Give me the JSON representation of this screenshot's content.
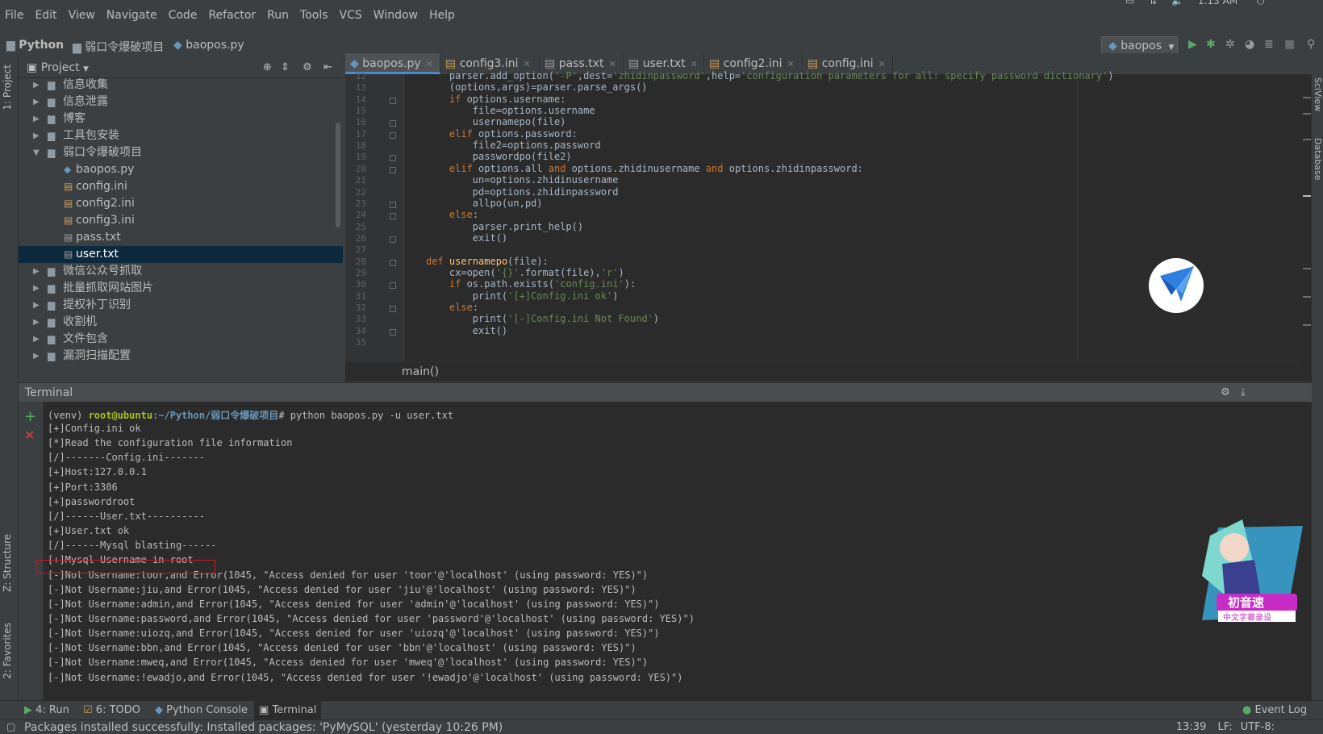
{
  "menu": [
    "File",
    "Edit",
    "View",
    "Navigate",
    "Code",
    "Refactor",
    "Run",
    "Tools",
    "VCS",
    "Window",
    "Help"
  ],
  "tray_time": "1:13 AM",
  "nav": {
    "crumbs": [
      "Python",
      "弱口令爆破项目",
      "baopos.py"
    ]
  },
  "run_config": "baopos",
  "left_tabs": {
    "project": "1: Project",
    "structure": "Z: Structure",
    "favorites": "2: Favorites"
  },
  "project": {
    "title": "Project",
    "items": [
      {
        "label": "信息收集",
        "type": "folder"
      },
      {
        "label": "信息泄露",
        "type": "folder"
      },
      {
        "label": "博客",
        "type": "folder"
      },
      {
        "label": "工具包安装",
        "type": "folder"
      },
      {
        "label": "弱口令爆破项目",
        "type": "folder-open"
      },
      {
        "label": "baopos.py",
        "type": "py"
      },
      {
        "label": "config.ini",
        "type": "ini"
      },
      {
        "label": "config2.ini",
        "type": "ini"
      },
      {
        "label": "config3.ini",
        "type": "ini"
      },
      {
        "label": "pass.txt",
        "type": "txt"
      },
      {
        "label": "user.txt",
        "type": "txt"
      },
      {
        "label": "微信公众号抓取",
        "type": "folder"
      },
      {
        "label": "批量抓取网站图片",
        "type": "folder"
      },
      {
        "label": "提权补丁识别",
        "type": "folder"
      },
      {
        "label": "收割机",
        "type": "folder"
      },
      {
        "label": "文件包含",
        "type": "folder"
      },
      {
        "label": "漏洞扫描配置",
        "type": "folder"
      }
    ]
  },
  "editor": {
    "tabs": [
      "baopos.py",
      "config3.ini",
      "pass.txt",
      "user.txt",
      "config2.ini",
      "config.ini"
    ],
    "line_numbers": [
      "12",
      "13",
      "14",
      "15",
      "16",
      "17",
      "18",
      "19",
      "20",
      "21",
      "22",
      "23",
      "24",
      "25",
      "26",
      "27",
      "28",
      "29",
      "30",
      "31",
      "32",
      "33",
      "34",
      "35"
    ],
    "code": [
      "    parser.add_option('-P',dest='zhidinpassword',help='configuration parameters for all: specify password dictionary')",
      "    (options,args)=parser.parse_args()",
      "    if options.username:",
      "        file=options.username",
      "        usernamepo(file)",
      "    elif options.password:",
      "        file2=options.password",
      "        passwordpo(file2)",
      "    elif options.all and options.zhidinusername and options.zhidinpassword:",
      "        un=options.zhidinusername",
      "        pd=options.zhidinpassword",
      "        allpo(un,pd)",
      "    else:",
      "        parser.print_help()",
      "        exit()",
      "",
      "def usernamepo(file):",
      "    cx=open('{}'.format(file),'r')",
      "    if os.path.exists('config.ini'):",
      "        print('[+]Config.ini ok')",
      "    else:",
      "        print('[-]Config.ini Not Found')",
      "        exit()",
      ""
    ],
    "breadcrumb": "main()"
  },
  "terminal": {
    "title": "Terminal",
    "prompt_venv": "(venv) ",
    "prompt_user": "root@ubuntu",
    "prompt_path": ":~/Python/弱口令爆破项目",
    "prompt_cmd": "# python baopos.py -u user.txt",
    "lines": [
      "[+]Config.ini ok",
      "[*]Read the configuration file information",
      "[/]-------Config.ini-------",
      "[+]Host:127.0.0.1",
      "[+]Port:3306",
      "[+]passwordroot",
      "[/]------User.txt----------",
      "[+]User.txt ok",
      "[/]------Mysql blasting------",
      "[+]Mysql Username in root",
      "[-]Not Username:toor,and Error(1045, \"Access denied for user 'toor'@'localhost' (using password: YES)\")",
      "[-]Not Username:jiu,and Error(1045, \"Access denied for user 'jiu'@'localhost' (using password: YES)\")",
      "[-]Not Username:admin,and Error(1045, \"Access denied for user 'admin'@'localhost' (using password: YES)\")",
      "[-]Not Username:password,and Error(1045, \"Access denied for user 'password'@'localhost' (using password: YES)\")",
      "[-]Not Username:uiozq,and Error(1045, \"Access denied for user 'uiozq'@'localhost' (using password: YES)\")",
      "[-]Not Username:bbn,and Error(1045, \"Access denied for user 'bbn'@'localhost' (using password: YES)\")",
      "[-]Not Username:mweq,and Error(1045, \"Access denied for user 'mweq'@'localhost' (using password: YES)\")",
      "[-]Not Username:!ewadjo,and Error(1045, \"Access denied for user '!ewadjo'@'localhost' (using password: YES)\")"
    ]
  },
  "sticker_text": [
    "初音速",
    "中文字幕录设"
  ],
  "bottom_tools": [
    "4: Run",
    "6: TODO",
    "Python Console",
    "Terminal"
  ],
  "event_log": "Event Log",
  "status": {
    "message": "Packages installed successfully: Installed packages: 'PyMySQL' (yesterday 10:26 PM)",
    "position": "13:39",
    "line_sep": "LF:",
    "encoding": "UTF-8:"
  },
  "colors": {
    "accent": "#4a88c7",
    "keyword": "#cc7832",
    "string": "#6a8759",
    "prompt_green": "#a8c023",
    "prompt_blue": "#6897bb",
    "highlight_red": "#d11a1a"
  }
}
